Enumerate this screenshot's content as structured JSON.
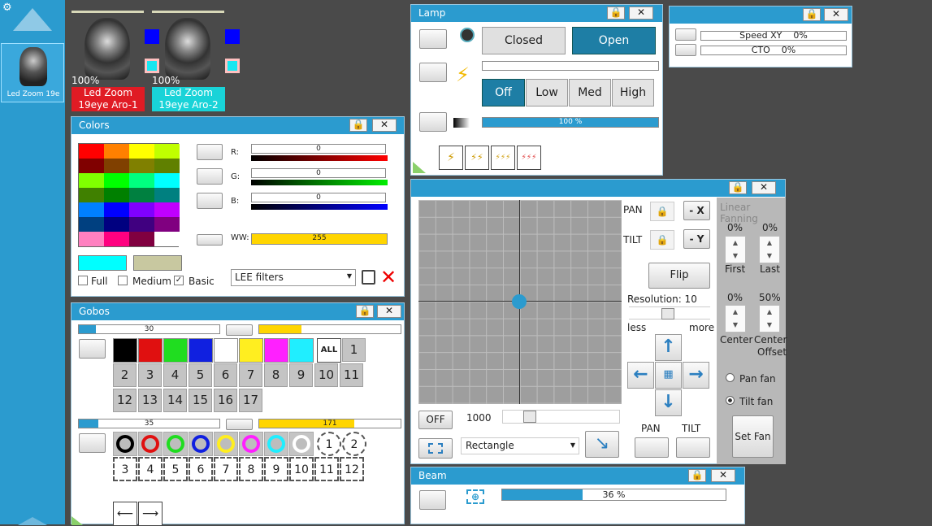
{
  "sidebar": {
    "fixture_label": "Led Zoom 19e"
  },
  "fixtures": [
    {
      "percent": "100%",
      "name_line1": "Led Zoom",
      "name_line2": "19eye Aro-1",
      "color": "#e01b24"
    },
    {
      "percent": "100%",
      "name_line1": "Led Zoom",
      "name_line2": "19eye Aro-2",
      "color": "#19d3d8"
    }
  ],
  "lamp": {
    "title": "Lamp",
    "closed": "Closed",
    "open": "Open",
    "off": "Off",
    "low": "Low",
    "med": "Med",
    "high": "High",
    "progress_label": "100 %",
    "progress": 1.0
  },
  "speed": {
    "speed_label": "Speed XY",
    "speed_value": "0%",
    "cto_label": "CTO",
    "cto_value": "0%"
  },
  "colors": {
    "title": "Colors",
    "r_label": "R:",
    "g_label": "G:",
    "b_label": "B:",
    "ww_label": "WW:",
    "r_value": "0",
    "g_value": "0",
    "b_value": "0",
    "ww_value": "255",
    "ww_level": 1.0,
    "full": "Full",
    "medium": "Medium",
    "basic": "Basic",
    "filter": "LEE filters",
    "palette": [
      "#ff0000",
      "#ff8000",
      "#ffff00",
      "#c0ff00",
      "#800000",
      "#804000",
      "#808000",
      "#608000",
      "#80ff00",
      "#00ff00",
      "#00ff80",
      "#00ffff",
      "#408000",
      "#008000",
      "#008040",
      "#008080",
      "#0080ff",
      "#0000ff",
      "#8000ff",
      "#c000ff",
      "#004080",
      "#000080",
      "#400080",
      "#800080",
      "#ff80c0",
      "#ff0080",
      "#800040",
      "#ffffff"
    ],
    "swatch1": "#00ffff",
    "swatch2": "#c8c8a0"
  },
  "gobos": {
    "title": "Gobos",
    "bar1": "30",
    "bar1_level": 0.12,
    "bar2": "35",
    "bar2_level": 0.14,
    "bar3": "171",
    "bar3_level": 0.67,
    "bar4_level": 0.3,
    "all": "ALL",
    "color_boxes": [
      "#000000",
      "#e01010",
      "#20dd20",
      "#1020e0",
      "#ffffff",
      "#ffee20",
      "#ff20ff",
      "#20eeff"
    ],
    "nums1": [
      "1"
    ],
    "nums2": [
      "2",
      "3",
      "4",
      "5",
      "6",
      "7",
      "8",
      "9",
      "10",
      "11"
    ],
    "nums3": [
      "12",
      "13",
      "14",
      "15",
      "16",
      "17"
    ],
    "rings": [
      "#000000",
      "#e01010",
      "#20dd20",
      "#1020e0",
      "#ffee20",
      "#ff20ff",
      "#20eeff",
      "#ffffff"
    ],
    "ring_nums": [
      "1",
      "2"
    ],
    "ring_nums2": [
      "3",
      "4",
      "5",
      "6",
      "7",
      "8",
      "9",
      "10",
      "11",
      "12"
    ]
  },
  "pantilt": {
    "pan": "PAN",
    "tilt": "TILT",
    "minus_x": "- X",
    "minus_y": "- Y",
    "flip": "Flip",
    "resolution": "Resolution: 10",
    "less": "less",
    "more": "more",
    "off": "OFF",
    "speed": "1000",
    "shape": "Rectangle",
    "pan_btn": "PAN",
    "tilt_btn": "TILT",
    "linear": "Linear Fanning",
    "first_pct": "0%",
    "last_pct": "0%",
    "first": "First",
    "last": "Last",
    "center_pct": "0%",
    "offset_pct": "50%",
    "center": "Center",
    "center_offset_1": "Center",
    "center_offset_2": "Offset",
    "pan_fan": "Pan fan",
    "tilt_fan": "Tilt fan",
    "set_fan": "Set Fan"
  },
  "beam": {
    "title": "Beam",
    "progress_label": "36 %",
    "progress": 0.36
  }
}
